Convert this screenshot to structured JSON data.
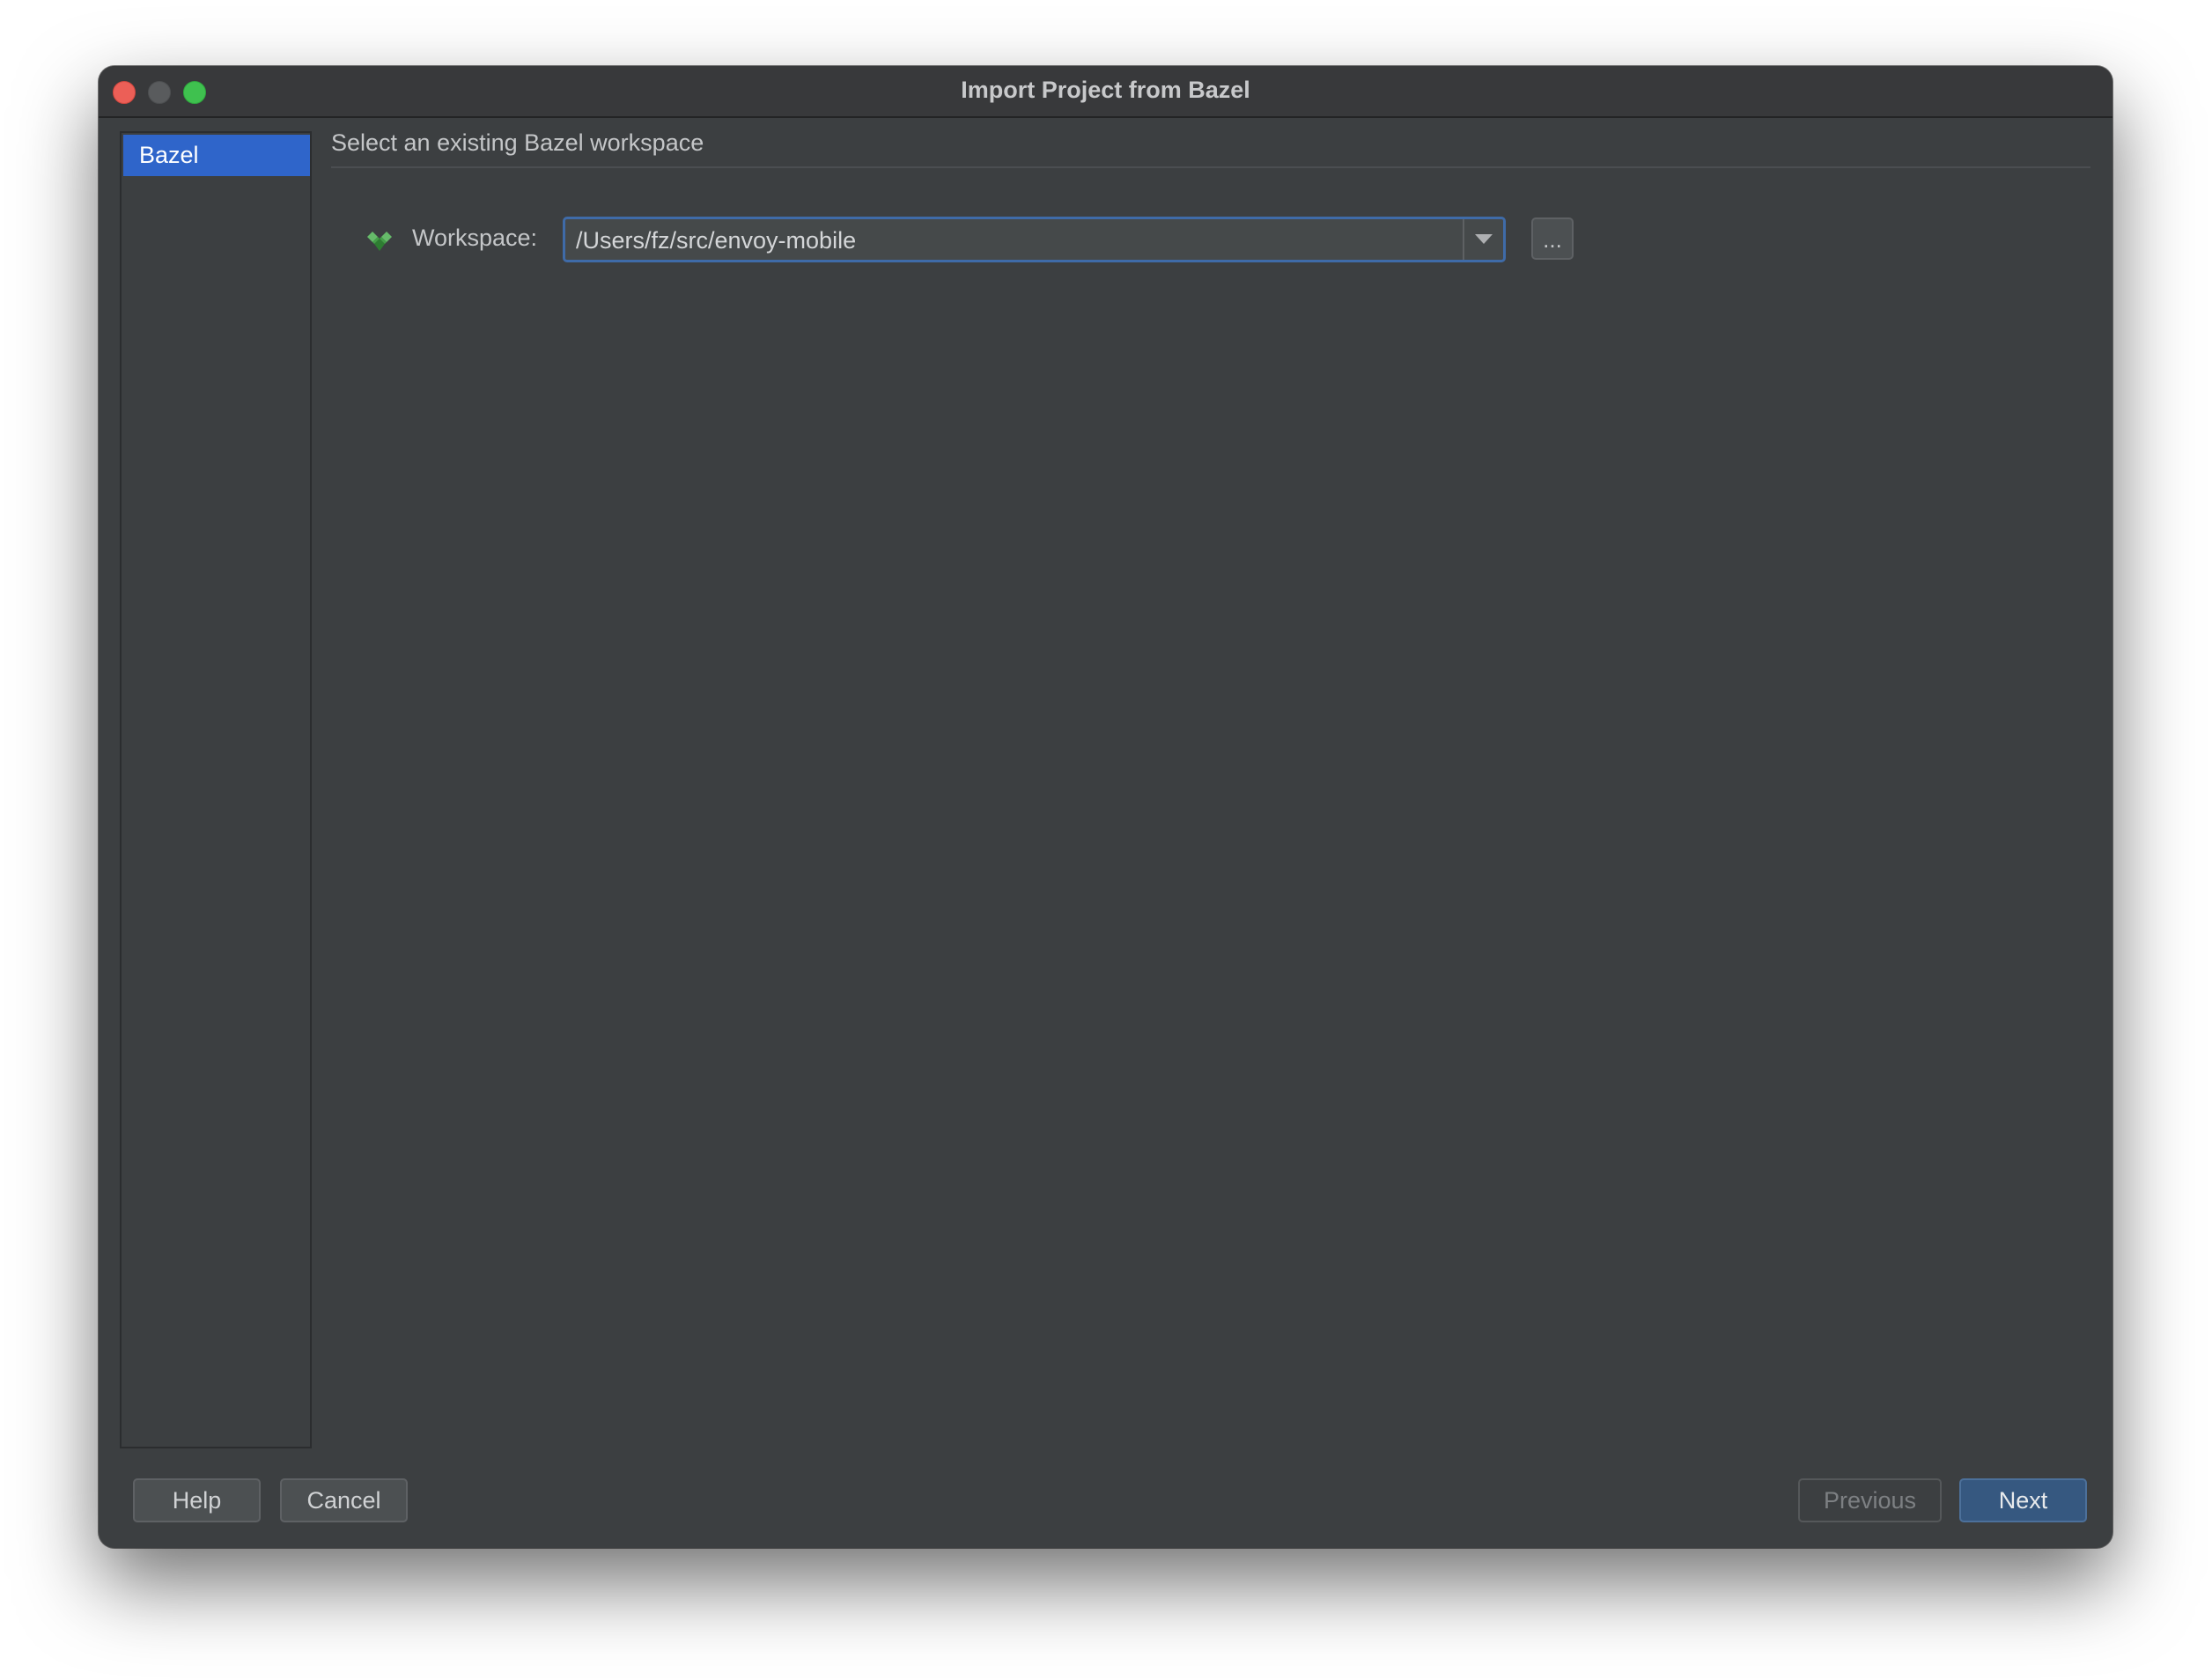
{
  "window": {
    "title": "Import Project from Bazel"
  },
  "sidebar": {
    "items": [
      {
        "label": "Bazel",
        "selected": true
      }
    ]
  },
  "main": {
    "header": "Select an existing Bazel workspace",
    "workspace": {
      "icon": "bazel-icon",
      "label": "Workspace:",
      "value": "/Users/fz/src/envoy-mobile",
      "browse_label": "..."
    }
  },
  "footer": {
    "help_label": "Help",
    "cancel_label": "Cancel",
    "previous_label": "Previous",
    "next_label": "Next"
  },
  "colors": {
    "background": "#3c3f41",
    "selection": "#2f65ca",
    "focus_border": "#3f6ba8",
    "default_button": "#365880",
    "bazel_green": "#43a047"
  }
}
